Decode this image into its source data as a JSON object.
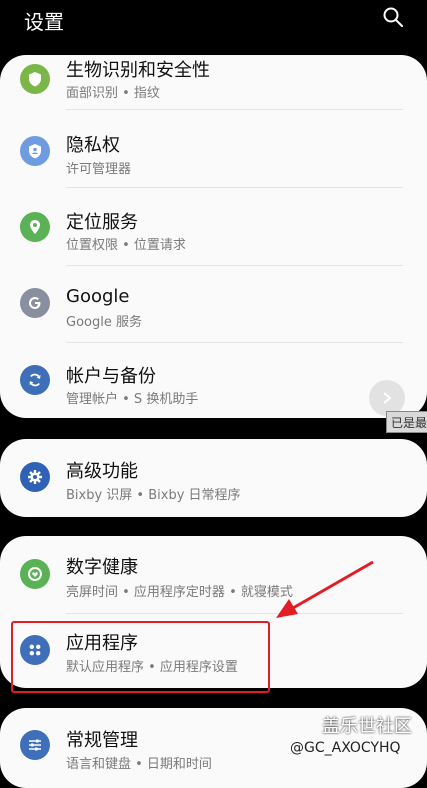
{
  "header": {
    "title": "设置"
  },
  "groups": [
    {
      "items": [
        {
          "title": "生物识别和安全性",
          "subtitle": "面部识别 • 指纹",
          "icon": "shield-icon",
          "color": "#7ab648"
        },
        {
          "title": "隐私权",
          "subtitle": "许可管理器",
          "icon": "privacy-icon",
          "color": "#6f9be0"
        },
        {
          "title": "定位服务",
          "subtitle": "位置权限 • 位置请求",
          "icon": "location-pin-icon",
          "color": "#5bb155"
        },
        {
          "title": "Google",
          "subtitle": "Google 服务",
          "icon": "google-icon",
          "color": "#8a8fa0"
        },
        {
          "title": "帐户与备份",
          "subtitle": "管理帐户 • S 换机助手",
          "icon": "sync-icon",
          "color": "#3f6fb8"
        }
      ]
    },
    {
      "items": [
        {
          "title": "高级功能",
          "subtitle": "Bixby 识屏 • Bixby 日常程序",
          "icon": "gear-plus-icon",
          "color": "#2f62b5"
        }
      ]
    },
    {
      "items": [
        {
          "title": "数字健康",
          "subtitle": "亮屏时间 • 应用程序定时器 • 就寝模式",
          "icon": "wellbeing-icon",
          "color": "#5bb155"
        },
        {
          "title": "应用程序",
          "subtitle": "默认应用程序 • 应用程序设置",
          "icon": "apps-grid-icon",
          "color": "#3f6fb8"
        }
      ]
    },
    {
      "items": [
        {
          "title": "常规管理",
          "subtitle": "语言和键盘 • 日期和时间",
          "icon": "sliders-icon",
          "color": "#3f6fb8"
        }
      ]
    }
  ],
  "tooltip": "已是最",
  "watermark": {
    "brand": "盖乐世社区",
    "handle": "@GC_AXOCYHQ"
  },
  "annotation_color": "#e21e24"
}
